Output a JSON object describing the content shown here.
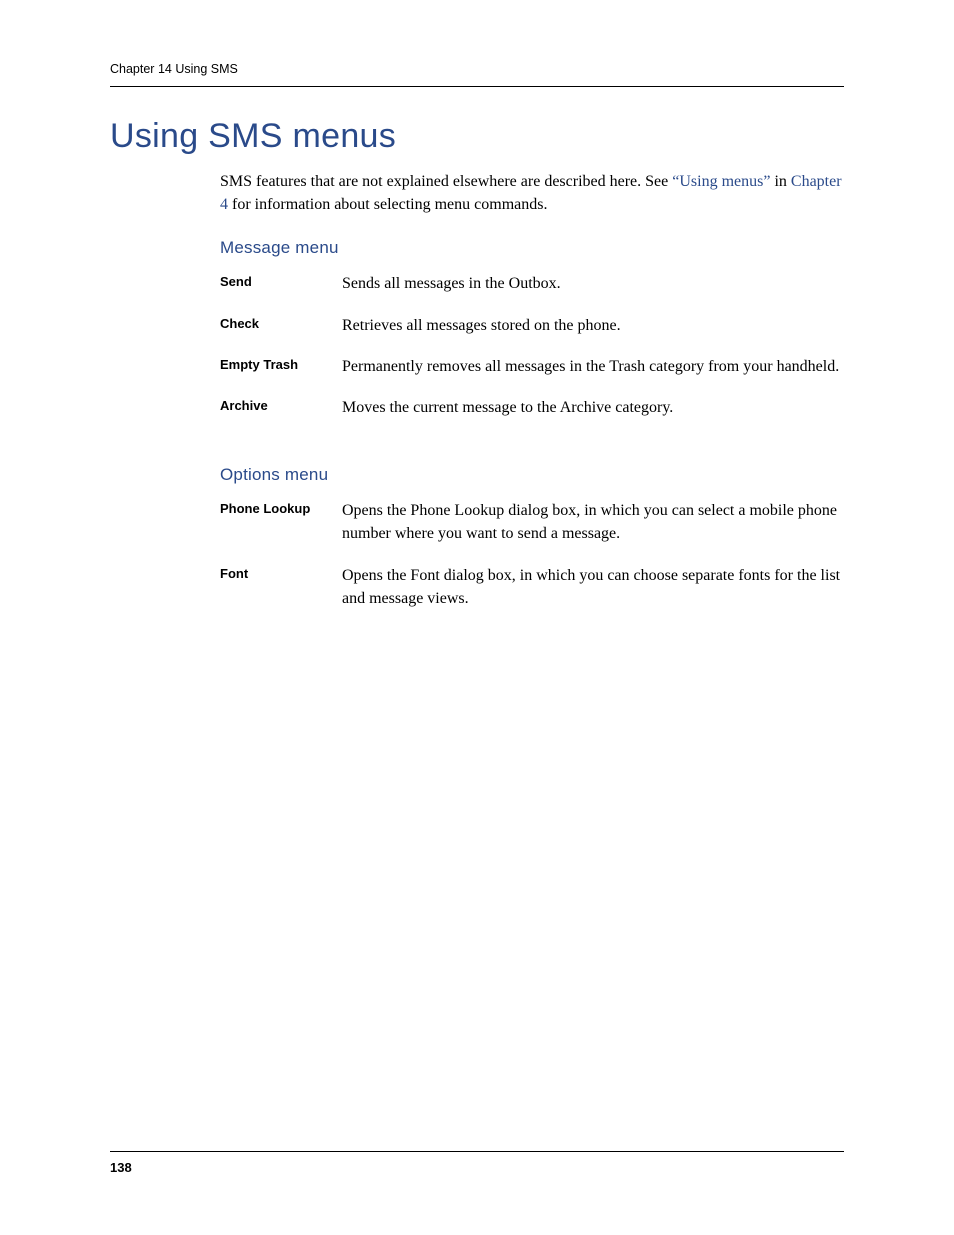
{
  "header": {
    "running_head": "Chapter 14   Using SMS"
  },
  "title": "Using SMS menus",
  "intro": {
    "pre": "SMS features that are not explained elsewhere are described here. See ",
    "link1": "“Using menus”",
    "mid": " in ",
    "link2": "Chapter 4",
    "post": " for information about selecting menu commands."
  },
  "sections": {
    "message": {
      "heading": "Message menu",
      "rows": [
        {
          "term": "Send",
          "desc": "Sends all messages in the Outbox."
        },
        {
          "term": "Check",
          "desc": "Retrieves all messages stored on the phone."
        },
        {
          "term": "Empty Trash",
          "desc": "Permanently removes all messages in the Trash category from your handheld."
        },
        {
          "term": "Archive",
          "desc": "Moves the current message to the Archive category."
        }
      ]
    },
    "options": {
      "heading": "Options menu",
      "rows": [
        {
          "term": "Phone Lookup",
          "desc": "Opens the Phone Lookup dialog box, in which you can select a mobile phone number where you want to send a message."
        },
        {
          "term": "Font",
          "desc": "Opens the Font dialog box, in which you can choose separate fonts for the list and message views."
        }
      ]
    }
  },
  "page_number": "138"
}
